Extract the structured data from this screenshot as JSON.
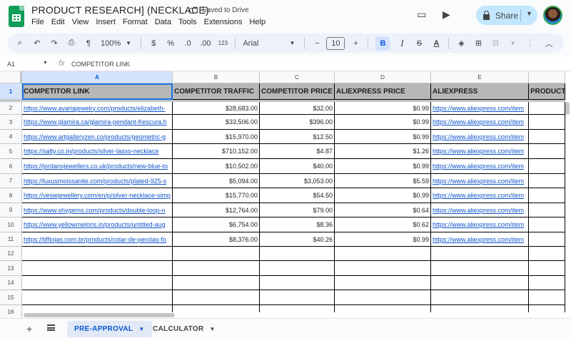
{
  "app": {
    "doc_title": "PRODUCT RESEARCH] (NECKLACE)",
    "saved_status": "Saved to Drive",
    "share_label": "Share",
    "menu": [
      "File",
      "Edit",
      "View",
      "Insert",
      "Format",
      "Data",
      "Tools",
      "Extensions",
      "Help"
    ]
  },
  "toolbar": {
    "zoom": "100%",
    "currency": "$",
    "percent": "%",
    "dec_decrease": ".0",
    "dec_increase": ".00",
    "number_format": "123",
    "font": "Arial",
    "font_size": "10",
    "minus": "−",
    "plus": "+",
    "bold": "B",
    "italic": "I",
    "strike": "S",
    "text_color": "A"
  },
  "formula_bar": {
    "cell_ref": "A1",
    "fx": "fx",
    "content": "COMPETITOR LINK"
  },
  "grid": {
    "columns": [
      "A",
      "B",
      "C",
      "D",
      "E"
    ],
    "rows": [
      "1",
      "2",
      "3",
      "4",
      "5",
      "6",
      "7",
      "8",
      "9",
      "10",
      "11",
      "12",
      "13",
      "14",
      "15",
      "16"
    ],
    "headers": [
      "COMPETITOR LINK",
      "COMPETITOR TRAFFIC",
      "COMPETITOR PRICE",
      "ALIEXPRESS PRICE",
      "ALIEXPRESS",
      "PRODUCT"
    ],
    "data": [
      [
        "https://www.avariajewelry.com/products/elizabeth-",
        "$28,683.00",
        "$32.00",
        "$0.99",
        "https://www.aliexpress.com/item"
      ],
      [
        "https://www.glamira.ca/glamira-pendant-frescura.h",
        "$33,506.00",
        "$396.00",
        "$0.99",
        "https://www.aliexpress.com/item"
      ],
      [
        "https://www.artgalleryzen.co/products/geometric-g",
        "$15,970.00",
        "$12.50",
        "$0.99",
        "https://www.aliexpress.com/item"
      ],
      [
        "https://salty.co.in/products/silver-lasso-necklace",
        "$710,152.00",
        "$4.87",
        "$1.26",
        "https://www.aliexpress.com/item"
      ],
      [
        "https://jordansjewellers.co.uk/products/new-blue-to",
        "$10,502.00",
        "$40.00",
        "$0.99",
        "https://www.aliexpress.com/item"
      ],
      [
        "https://luxusmoissanite.com/products/plated-925-s",
        "$5,094.00",
        "$3,053.00",
        "$5.59",
        "https://www.aliexpress.com/item"
      ],
      [
        "https://vesiejewellery.com/en/p/silver-necklace-simp",
        "$15,770.00",
        "$54.50",
        "$0.99",
        "https://www.aliexpress.com/item"
      ],
      [
        "https://www.shygems.com/products/double-loop-n",
        "$12,764.00",
        "$79.00",
        "$0.64",
        "https://www.aliexpress.com/item"
      ],
      [
        "https://www.yellowmelons.in/products/untitled-aug",
        "$6,754.00",
        "$8.36",
        "$0.62",
        "https://www.aliexpress.com/item"
      ],
      [
        "https://tiffiojas.com.br/products/colar-de-perolas-fo",
        "$8,376.00",
        "$40.26",
        "$0.99",
        "https://www.aliexpress.com/item"
      ]
    ]
  },
  "sheets": [
    {
      "label": "PRE-APPROVAL",
      "active": true
    },
    {
      "label": "CALCULATOR",
      "active": false
    }
  ],
  "colors": {
    "header_fill": "#b7b7b7",
    "link": "#1155cc",
    "selection": "#1a73e8",
    "share_bg": "#c2e7ff"
  }
}
